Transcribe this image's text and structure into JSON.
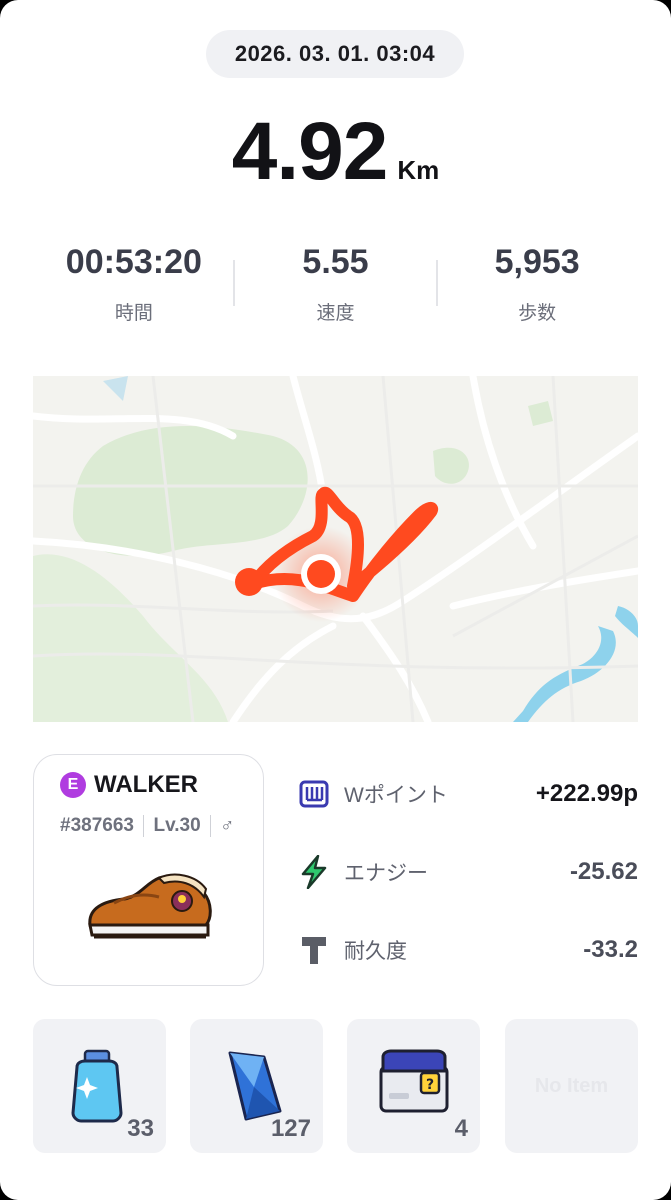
{
  "record": {
    "datetime": "2026. 03. 01. 03:04",
    "distance": "4.92",
    "distance_unit": "Km"
  },
  "stats": [
    {
      "value": "00:53:20",
      "label": "時間"
    },
    {
      "value": "5.55",
      "label": "速度"
    },
    {
      "value": "5,953",
      "label": "歩数"
    }
  ],
  "walker": {
    "badge": "E",
    "name": "WALKER",
    "id": "#387663",
    "level": "Lv.30",
    "gender": "♂"
  },
  "rewards": [
    {
      "icon": "w-point-icon",
      "label": "Wポイント",
      "value": "+222.99p"
    },
    {
      "icon": "lightning-icon",
      "label": "エナジー",
      "value": "-25.62"
    },
    {
      "icon": "durability-icon",
      "label": "耐久度",
      "value": "-33.2"
    }
  ],
  "items": [
    {
      "icon": "detergent-bottle-icon",
      "count": "33"
    },
    {
      "icon": "blue-crystal-icon",
      "count": "127"
    },
    {
      "icon": "mystery-box-icon",
      "count": "4"
    },
    {
      "empty_label": "No Item"
    }
  ],
  "colors": {
    "route": "#ff4a1f",
    "badge": "#b03ce0",
    "map_park": "#dcebd4",
    "map_water": "#8ed2ec"
  }
}
